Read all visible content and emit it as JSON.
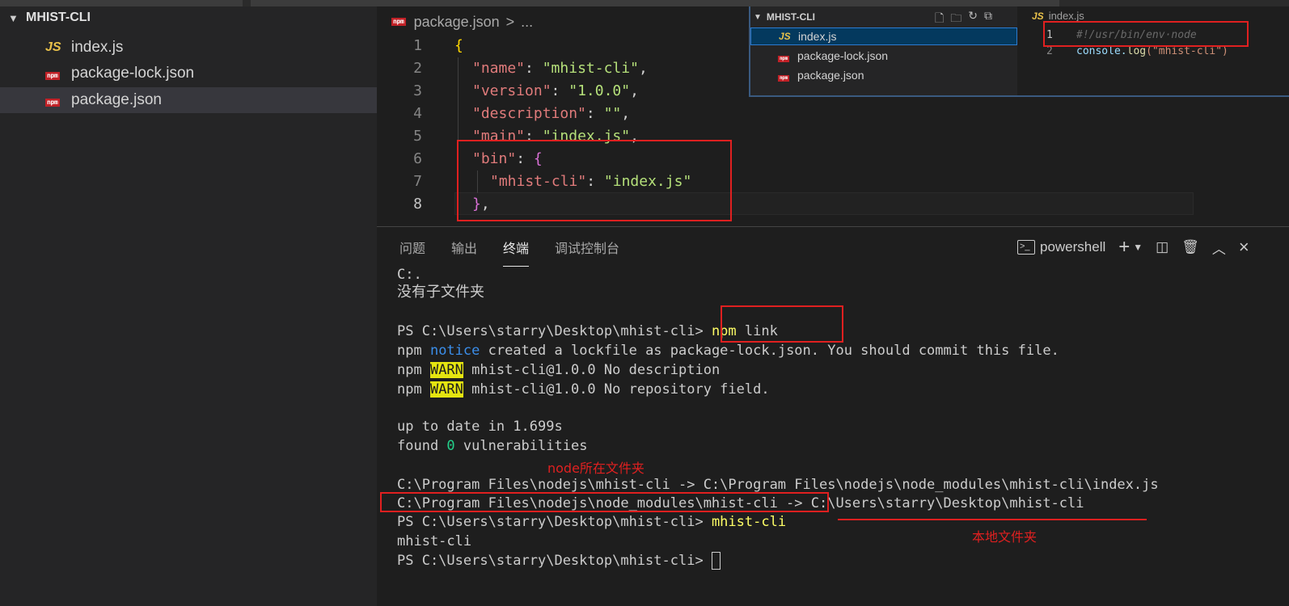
{
  "explorer": {
    "title": "MHIST-CLI",
    "files": [
      {
        "name": "index.js",
        "icon": "js-icon"
      },
      {
        "name": "package-lock.json",
        "icon": "npm-icon"
      },
      {
        "name": "package.json",
        "icon": "npm-icon",
        "selected": true
      }
    ]
  },
  "icons": {
    "js": "JS",
    "npm": "npm"
  },
  "breadcrumb": {
    "file": "package.json",
    "separator": ">",
    "more": "..."
  },
  "editor": {
    "line_numbers": [
      "1",
      "2",
      "3",
      "4",
      "5",
      "6",
      "7",
      "8"
    ],
    "lines": {
      "l1_brace": "{",
      "l2_key": "\"name\"",
      "l2_val": "\"mhist-cli\"",
      "l3_key": "\"version\"",
      "l3_val": "\"1.0.0\"",
      "l4_key": "\"description\"",
      "l4_val": "\"\"",
      "l5_key": "\"main\"",
      "l5_val": "\"index.js\"",
      "l6_key": "\"bin\"",
      "l6_brace": "{",
      "l7_key": "\"mhist-cli\"",
      "l7_val": "\"index.js\"",
      "l8_brace": "}"
    }
  },
  "mini_window": {
    "title": "MHIST-CLI",
    "files": [
      "index.js",
      "package-lock.json",
      "package.json"
    ],
    "tab": "index.js",
    "line1_num": "1",
    "line1": "#!/usr/bin/env·node",
    "line2_num": "2",
    "line2_obj": "console.",
    "line2_fn": "log",
    "line2_arg": "(\"mhist-cli\")"
  },
  "panel": {
    "tabs": [
      "问题",
      "输出",
      "终端",
      "调试控制台"
    ],
    "active_tab": "终端",
    "shell": "powershell"
  },
  "terminal": {
    "l1": "C:.",
    "l2": "没有子文件夹",
    "l4_prompt": "PS C:\\Users\\starry\\Desktop\\mhist-cli> ",
    "l4_cmd": "npm",
    "l4_rest": " link",
    "l5_a": "npm ",
    "l5_notice": "notice",
    "l5_b": " created a lockfile as package-lock.json. You should commit this file.",
    "l6_a": "npm ",
    "l6_warn": "WARN",
    "l6_b": " mhist-cli@1.0.0 No description",
    "l7_a": "npm ",
    "l7_warn": "WARN",
    "l7_b": " mhist-cli@1.0.0 No repository field.",
    "l9": "up to date in 1.699s",
    "l10_a": "found ",
    "l10_zero": "0",
    "l10_b": " vulnerabilities",
    "l12": "C:\\Program Files\\nodejs\\mhist-cli -> C:\\Program Files\\nodejs\\node_modules\\mhist-cli\\index.js",
    "l13": "C:\\Program Files\\nodejs\\node_modules\\mhist-cli -> C:\\Users\\starry\\Desktop\\mhist-cli",
    "l14_prompt": "PS C:\\Users\\starry\\Desktop\\mhist-cli> ",
    "l14_cmd": "mhist-cli",
    "l15": "mhist-cli",
    "l16_prompt": "PS C:\\Users\\starry\\Desktop\\mhist-cli> "
  },
  "annotations": {
    "node_folder": "node所在文件夹",
    "local_folder": "本地文件夹"
  },
  "colors": {
    "annotation_red": "#e02020",
    "warn_bg": "#e5e510",
    "notice": "#3b8eea",
    "command": "#ffff66"
  }
}
